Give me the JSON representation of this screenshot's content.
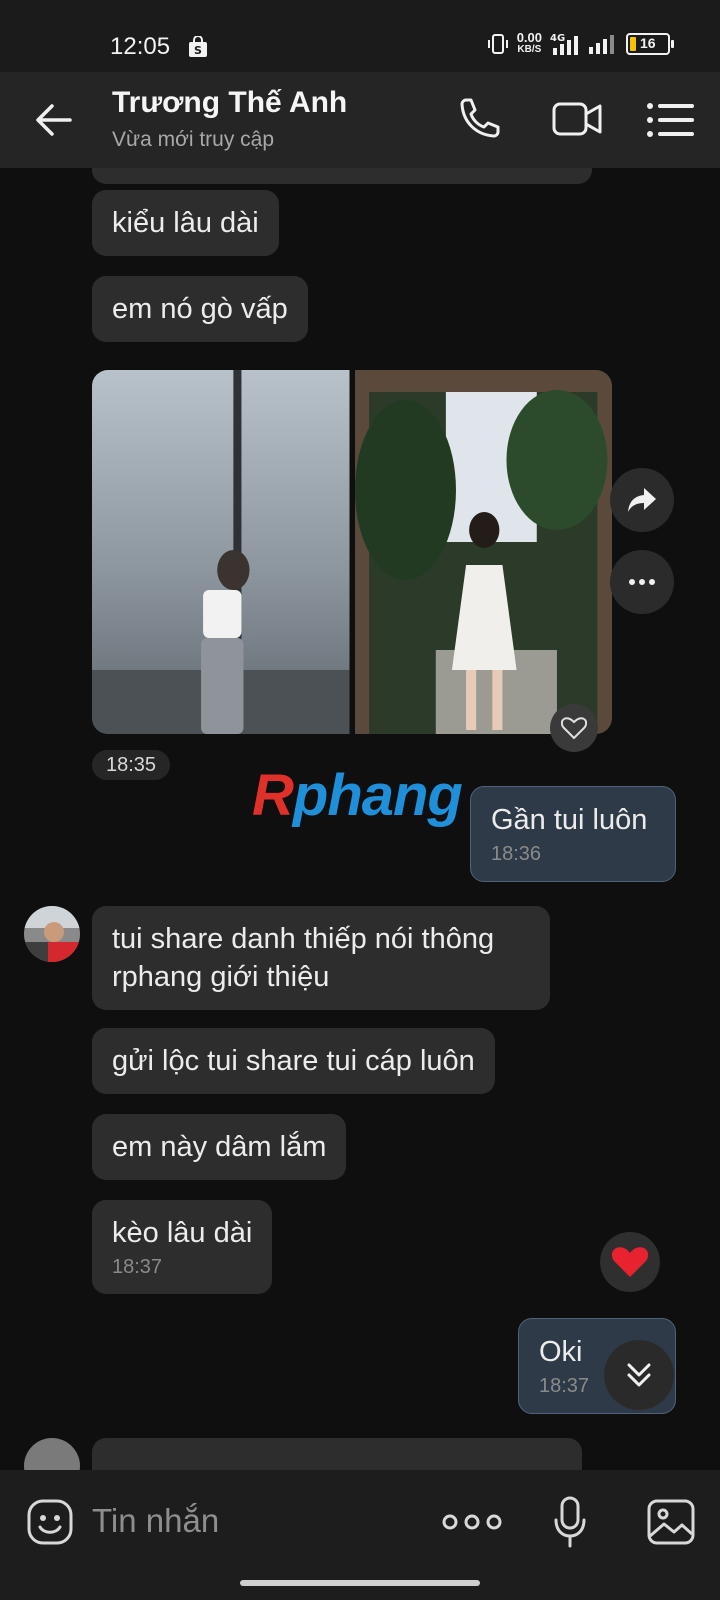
{
  "status_bar": {
    "time": "12:05",
    "net_speed": "0.00",
    "net_unit": "KB/S",
    "network_type": "4G",
    "battery_level": "16"
  },
  "header": {
    "name": "Trương Thế Anh",
    "status": "Vừa mới truy cập"
  },
  "messages": [
    {
      "dir": "in",
      "text": "kiểu lâu dài"
    },
    {
      "dir": "in",
      "text": "em nó gò vấp"
    },
    {
      "dir": "in",
      "type": "photos",
      "count": 2,
      "time": "18:35"
    },
    {
      "dir": "out",
      "text": "Gần tui luôn",
      "time": "18:36"
    },
    {
      "dir": "in",
      "text": "tui share danh thiếp nói thông rphang giới thiệu"
    },
    {
      "dir": "in",
      "text": "gửi lộc tui share tui cáp luôn"
    },
    {
      "dir": "in",
      "text": "em này dâm lắm"
    },
    {
      "dir": "in",
      "text": "kèo lâu dài",
      "time": "18:37",
      "reaction": "heart"
    },
    {
      "dir": "out",
      "text": "Oki",
      "time": "18:37"
    }
  ],
  "watermark": {
    "first": "R",
    "rest": "phang"
  },
  "input": {
    "placeholder": "Tin nhắn"
  },
  "colors": {
    "background": "#0f0f0f",
    "bubble_in": "#2d2d2d",
    "bubble_out": "#2f3a48",
    "reaction_heart": "#e8222f"
  }
}
